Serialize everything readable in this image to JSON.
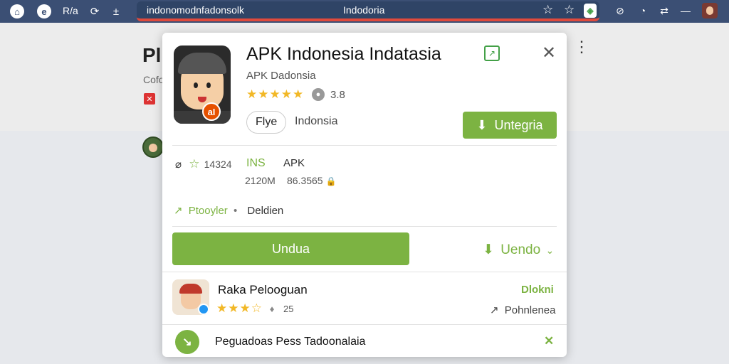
{
  "browser": {
    "nav_glyphs": [
      "⌂",
      "e",
      "R/a",
      "⟳",
      "±"
    ],
    "url": "indonomodnfadonsolk",
    "page_title": "Indodoria",
    "bookmark_glyphs": [
      "☆",
      "☆"
    ],
    "extension_glyph": "◈",
    "right_glyphs": [
      "⊘",
      "◔",
      "⇄",
      "—"
    ]
  },
  "background": {
    "title": "Pl",
    "subtitle": "Cofo",
    "badge": "✕"
  },
  "dialog": {
    "app_title": "APK Indonesia Indatasia",
    "developer": "APK Dadonsia",
    "stars": "★★★★★",
    "rating_user_glyph": "●",
    "rating_value": "3.8",
    "badge_text": "aI",
    "pill_label": "Flye",
    "region": "Indonsia",
    "top_button_label": "Untegria",
    "top_button_icon": "⬇",
    "share_glyph": "↗",
    "close_glyph": "✕",
    "more_glyph": "⋮",
    "meta": {
      "row1_icon": "⌀",
      "row1_star": "☆",
      "row1_count": "14324",
      "row1_tag": "INS",
      "row1_type": "APK",
      "row2_size": "2120M",
      "row2_code": "86.3565",
      "row2_lock": "🔒",
      "row3_icon": "↗",
      "row3_label": "Ptooyler",
      "row3_dot": "•",
      "row3_value": "Deldien"
    },
    "main_button_label": "Undua",
    "download_link_label": "Uendo",
    "download_link_icon": "⬇",
    "download_link_chevron": "⌄"
  },
  "related": {
    "name": "Raka Pelooguan",
    "stars": "★★★☆",
    "thumb_glyph": "♦",
    "count": "25",
    "action_label": "Dlokni",
    "status_icon": "↗",
    "status_label": "Pohnlenea"
  },
  "footer": {
    "icon_glyph": "↘",
    "text": "Peguadoas Pess Tadoonalaia",
    "close_glyph": "✕"
  },
  "colors": {
    "topbar": "#3b4f74",
    "accent_green": "#7cb342",
    "star_yellow": "#f2b827",
    "address_underline": "#e04a3c"
  }
}
